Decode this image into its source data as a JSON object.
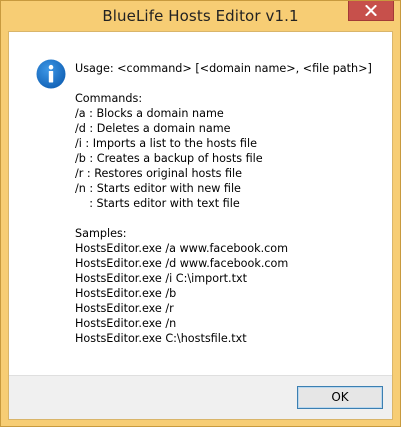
{
  "window": {
    "title": "BlueLife Hosts Editor v1.1",
    "close_icon": "close-icon"
  },
  "dialog": {
    "icon": "info-icon",
    "usage": "Usage: <command> [<domain name>, <file path>]",
    "commands_heading": "Commands:",
    "commands": [
      "/a : Blocks a domain name",
      "/d : Deletes a domain name",
      "/i : Imports a list to the hosts file",
      "/b : Creates a backup of hosts file",
      "/r : Restores original hosts file",
      "/n : Starts editor with new file",
      "    : Starts editor with text file"
    ],
    "samples_heading": "Samples:",
    "samples": [
      "HostsEditor.exe /a www.facebook.com",
      "HostsEditor.exe /d www.facebook.com",
      "HostsEditor.exe /i C:\\import.txt",
      "HostsEditor.exe /b",
      "HostsEditor.exe /r",
      "HostsEditor.exe /n",
      "HostsEditor.exe C:\\hostsfile.txt"
    ]
  },
  "footer": {
    "ok_label": "OK"
  },
  "colors": {
    "frame": "#f7cd74",
    "close_button": "#c7504b",
    "info_icon": "#1a73c8",
    "ok_border": "#3c7fb1"
  }
}
